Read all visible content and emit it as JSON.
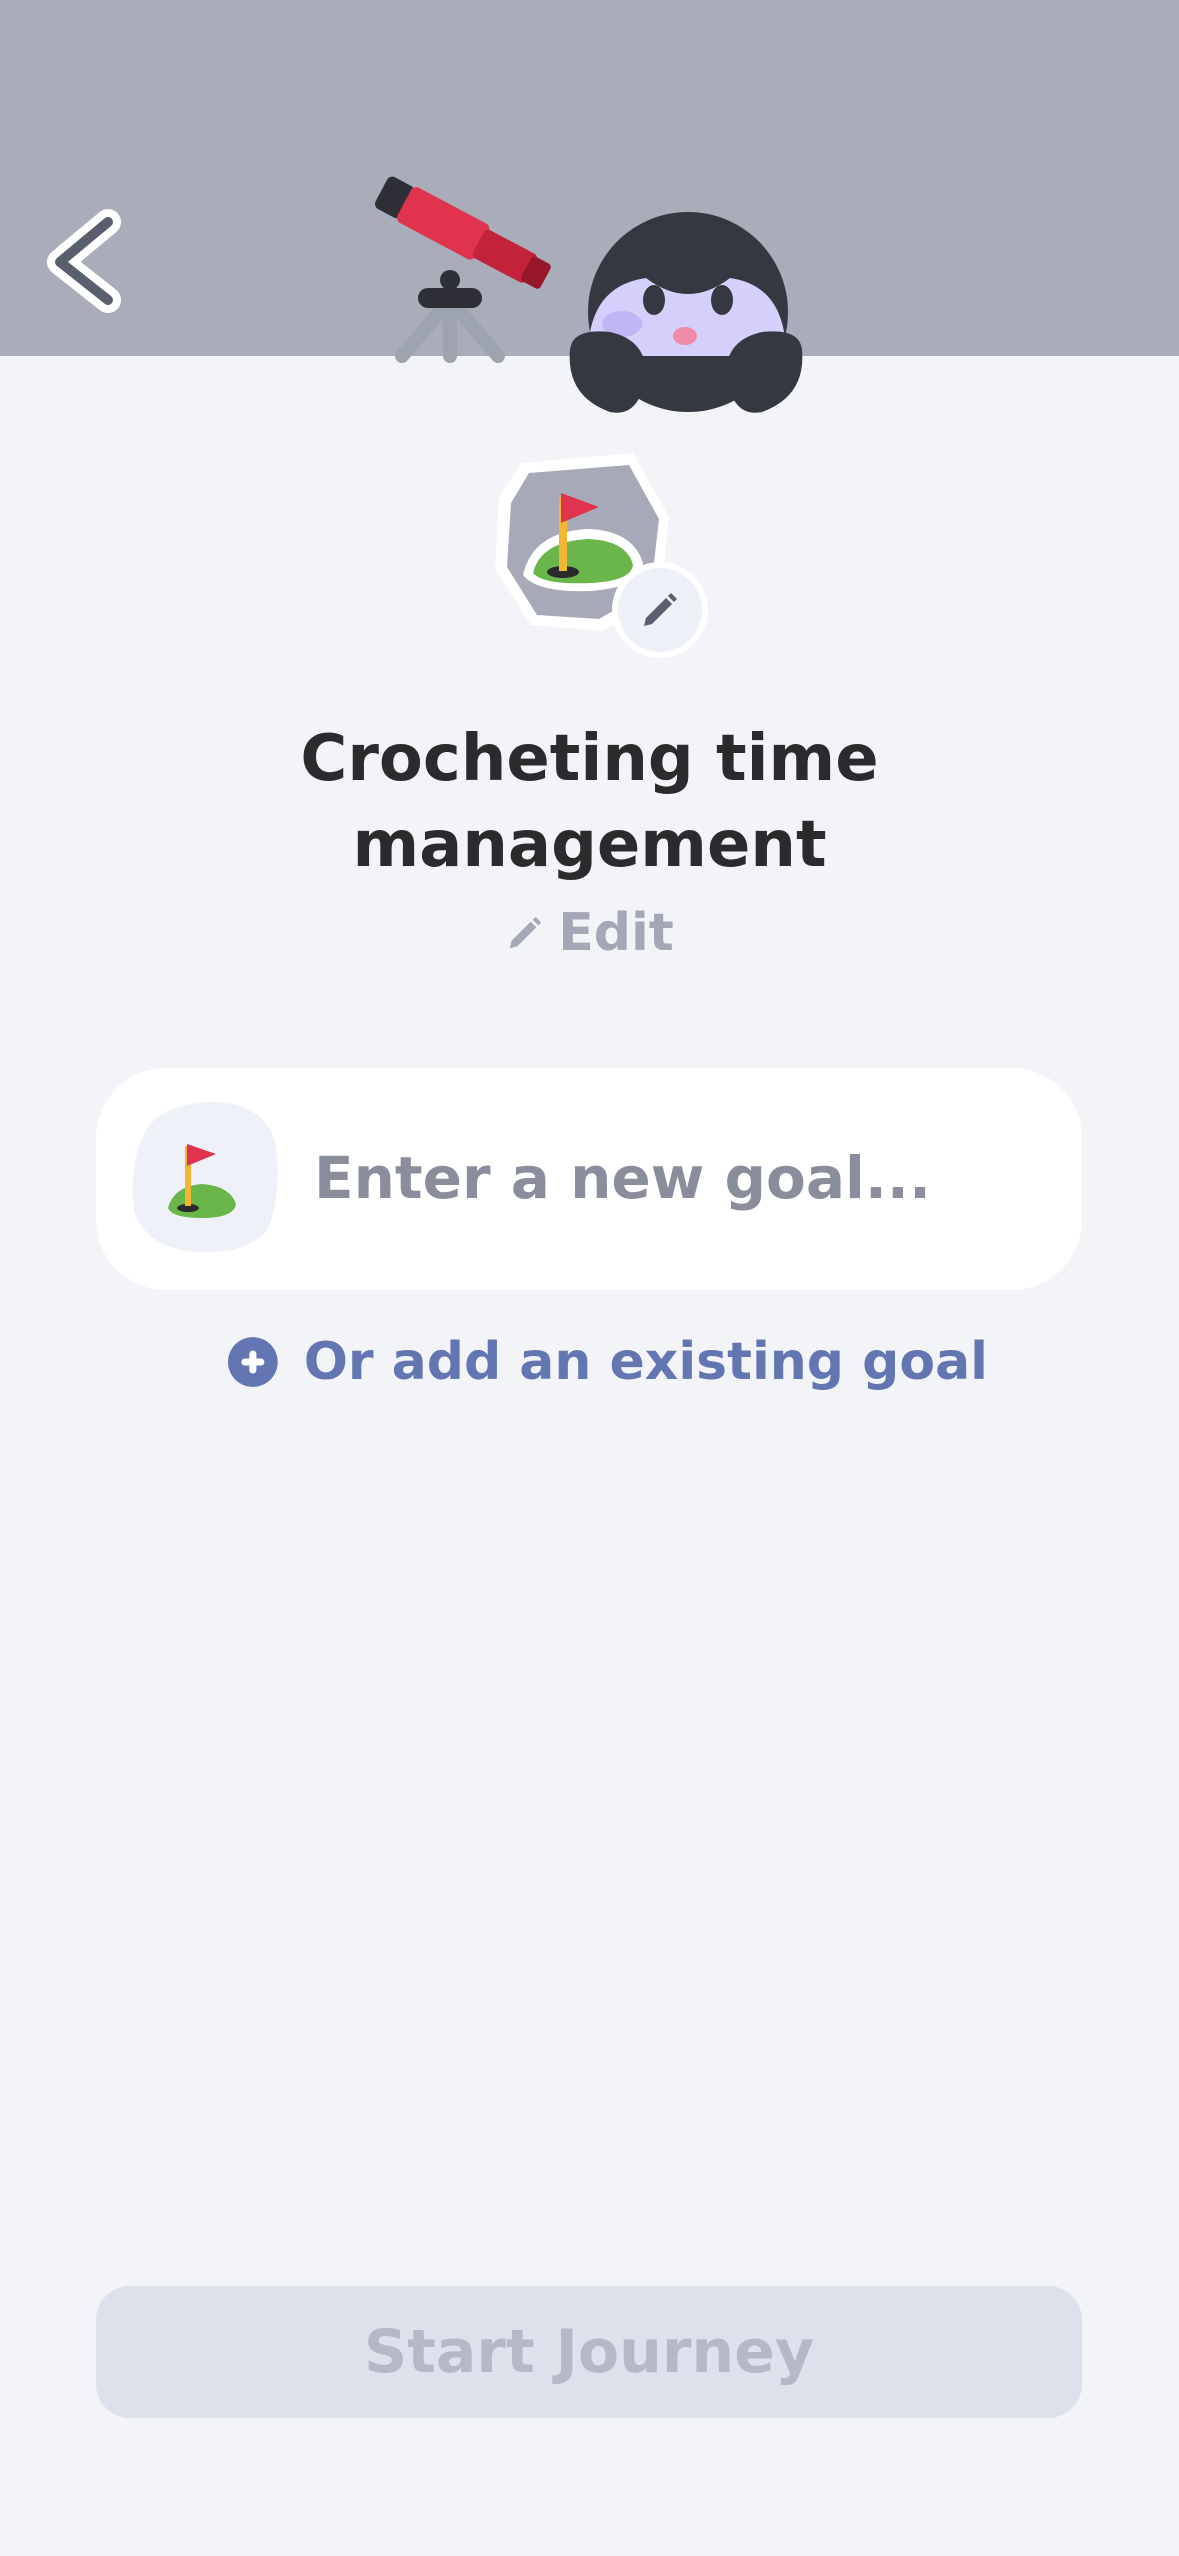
{
  "header": {
    "back_icon": "chevron-left-icon",
    "illustration": "penguin-with-telescope",
    "background_color": "#a9acb9"
  },
  "goal_group": {
    "icon": "flag-in-hole-icon",
    "title": "Crocheting time management",
    "edit_label": "Edit"
  },
  "new_goal": {
    "placeholder": "Enter a new goal...",
    "value": ""
  },
  "add_existing": {
    "label": "Or add an existing goal",
    "accent_color": "#6476b1"
  },
  "footer": {
    "start_label": "Start Journey",
    "disabled": true
  }
}
